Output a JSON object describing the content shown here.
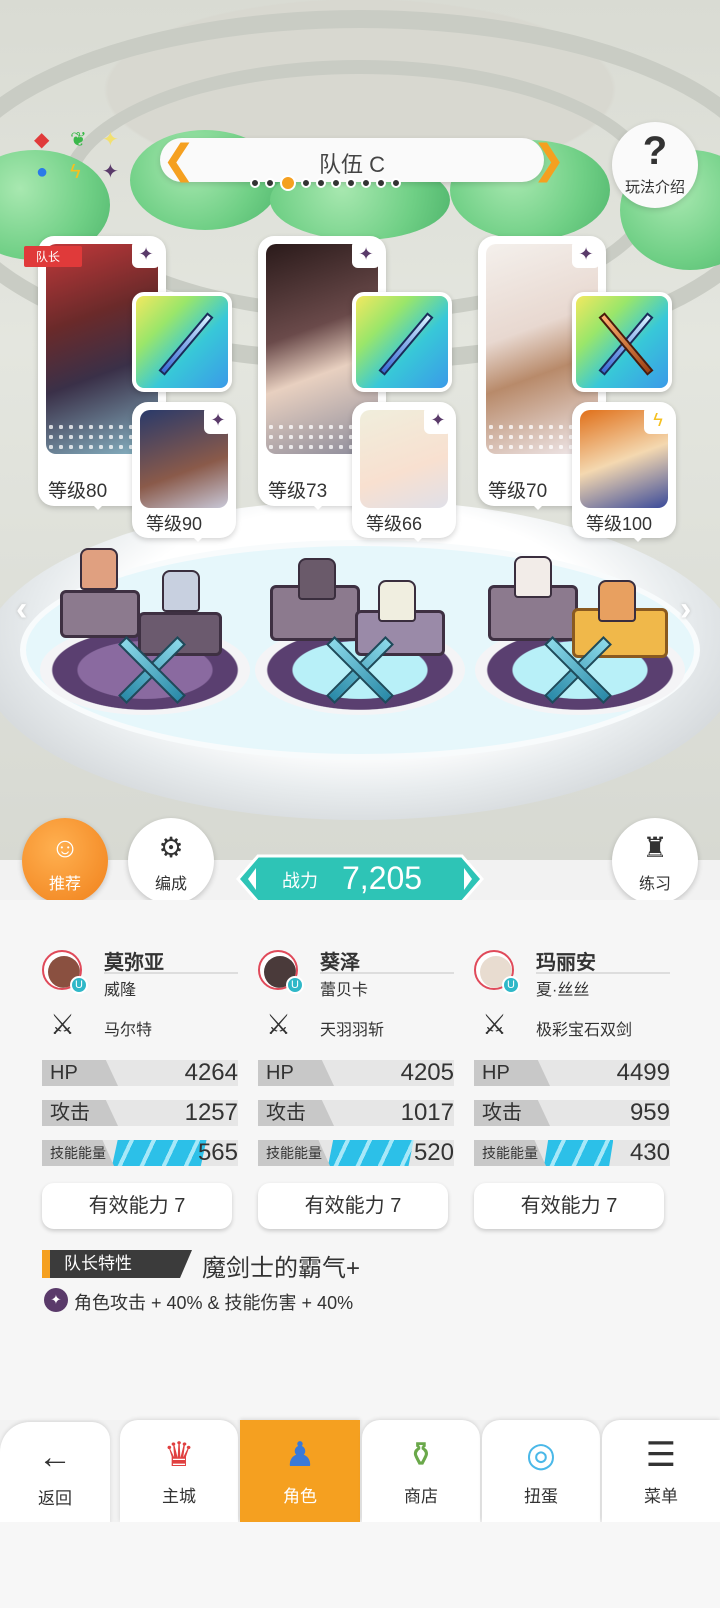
{
  "team": {
    "name": "队伍 C",
    "dot_count": 10,
    "active_dot": 2
  },
  "help_label": "玩法介绍",
  "leader_tag": "队长",
  "slots": [
    {
      "leader_level": "等级80",
      "support_level": "等级90"
    },
    {
      "leader_level": "等级73",
      "support_level": "等级66"
    },
    {
      "leader_level": "等级70",
      "support_level": "等级100"
    }
  ],
  "actions": {
    "recommend": "推荐",
    "formation": "编成",
    "practice": "练习"
  },
  "power": {
    "label": "战力",
    "value": "7,205"
  },
  "columns": [
    {
      "leader": "莫弥亚",
      "support": "威隆",
      "weapon": "马尔特",
      "hp_label": "HP",
      "hp": "4264",
      "atk_label": "攻击",
      "atk": "1257",
      "sp_label": "技能能量",
      "sp": "565",
      "sp_fill": 0.75,
      "effective": "有效能力 7"
    },
    {
      "leader": "葵泽",
      "support": "蕾贝卡",
      "weapon": "天羽羽斩",
      "hp_label": "HP",
      "hp": "4205",
      "atk_label": "攻击",
      "atk": "1017",
      "sp_label": "技能能量",
      "sp": "520",
      "sp_fill": 0.68,
      "effective": "有效能力 7"
    },
    {
      "leader": "玛丽安",
      "support": "夏·丝丝",
      "weapon": "极彩宝石双剑",
      "hp_label": "HP",
      "hp": "4499",
      "atk_label": "攻击",
      "atk": "959",
      "sp_label": "技能能量",
      "sp": "430",
      "sp_fill": 0.55,
      "effective": "有效能力 7"
    }
  ],
  "trait": {
    "tag": "队长特性",
    "title": "魔剑士的霸气+",
    "desc": "角色攻击 + 40% & 技能伤害 + 40%"
  },
  "nav": [
    {
      "label": "返回",
      "icon": "back-arrow-icon"
    },
    {
      "label": "主城",
      "icon": "castle-icon"
    },
    {
      "label": "角色",
      "icon": "character-icon",
      "active": true
    },
    {
      "label": "商店",
      "icon": "shop-icon"
    },
    {
      "label": "扭蛋",
      "icon": "gacha-icon"
    },
    {
      "label": "菜单",
      "icon": "menu-icon"
    }
  ],
  "colors": {
    "accent": "#f5a020",
    "power": "#2ec4b6",
    "skill_bar": "#2cc0e8"
  }
}
